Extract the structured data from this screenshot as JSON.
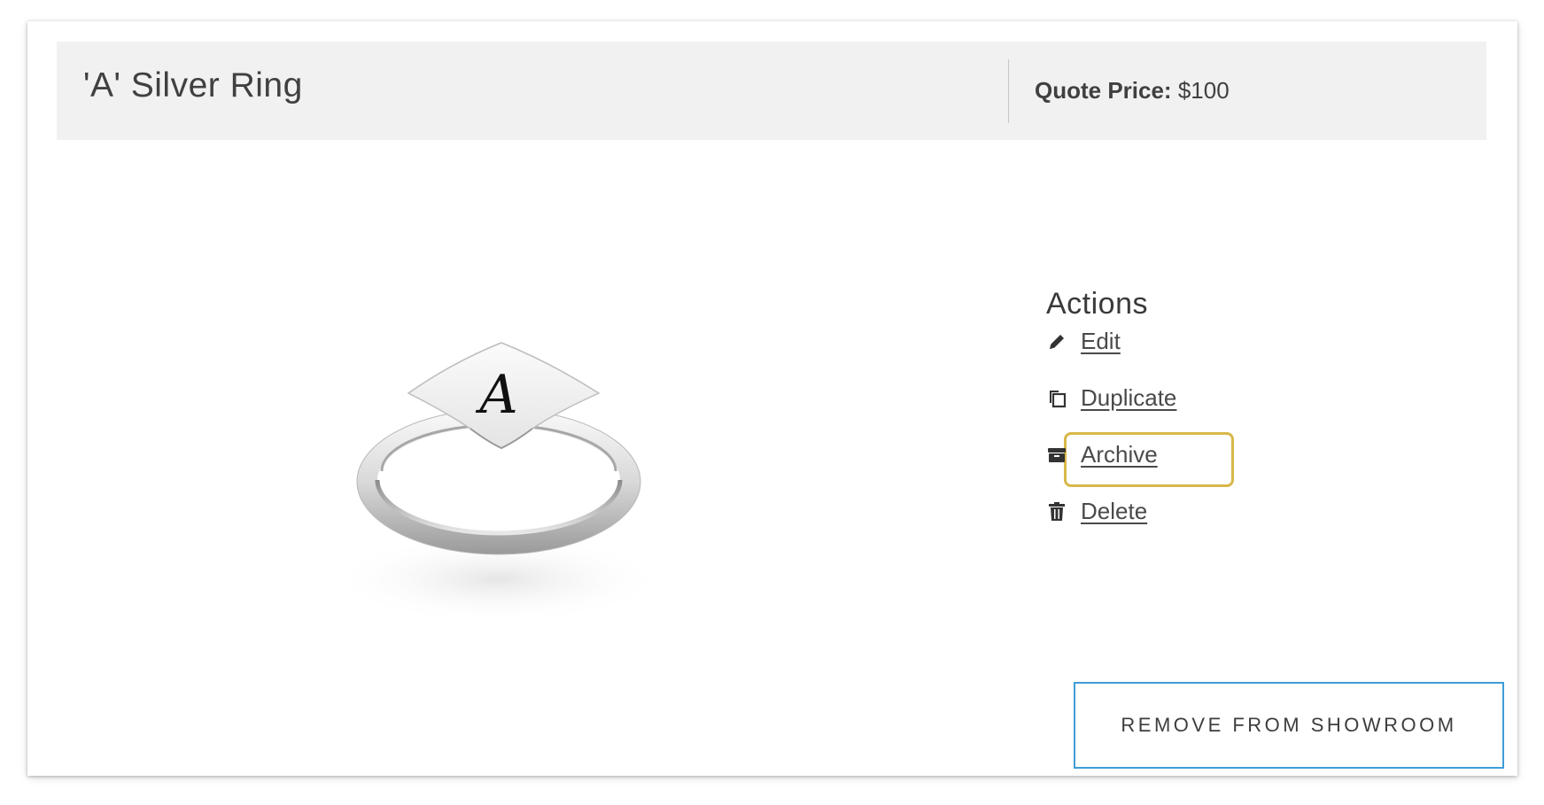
{
  "product": {
    "title": "'A' Silver Ring",
    "quote_label": "Quote Price:",
    "quote_value": "$100"
  },
  "image": {
    "alt": "'A' Silver Ring",
    "engraving": "A"
  },
  "actions": {
    "heading": "Actions",
    "items": [
      {
        "label": "Edit",
        "icon": "pencil-icon"
      },
      {
        "label": "Duplicate",
        "icon": "duplicate-icon"
      },
      {
        "label": "Archive",
        "icon": "archive-icon"
      },
      {
        "label": "Delete",
        "icon": "trash-icon"
      }
    ]
  },
  "remove_button": {
    "label": "REMOVE FROM SHOWROOM"
  },
  "colors": {
    "highlight": "#d8b84a",
    "button_border": "#3e9dd6",
    "header_bg": "#f1f1f1"
  }
}
